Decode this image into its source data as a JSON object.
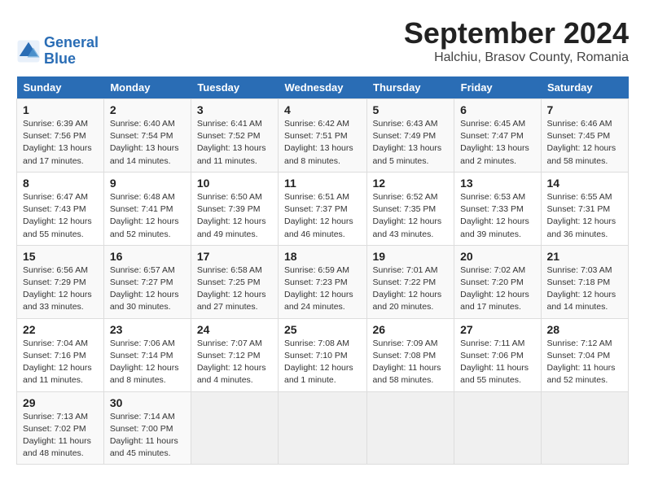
{
  "logo": {
    "line1": "General",
    "line2": "Blue"
  },
  "title": "September 2024",
  "subtitle": "Halchiu, Brasov County, Romania",
  "weekdays": [
    "Sunday",
    "Monday",
    "Tuesday",
    "Wednesday",
    "Thursday",
    "Friday",
    "Saturday"
  ],
  "weeks": [
    [
      {
        "day": "1",
        "info": "Sunrise: 6:39 AM\nSunset: 7:56 PM\nDaylight: 13 hours\nand 17 minutes."
      },
      {
        "day": "2",
        "info": "Sunrise: 6:40 AM\nSunset: 7:54 PM\nDaylight: 13 hours\nand 14 minutes."
      },
      {
        "day": "3",
        "info": "Sunrise: 6:41 AM\nSunset: 7:52 PM\nDaylight: 13 hours\nand 11 minutes."
      },
      {
        "day": "4",
        "info": "Sunrise: 6:42 AM\nSunset: 7:51 PM\nDaylight: 13 hours\nand 8 minutes."
      },
      {
        "day": "5",
        "info": "Sunrise: 6:43 AM\nSunset: 7:49 PM\nDaylight: 13 hours\nand 5 minutes."
      },
      {
        "day": "6",
        "info": "Sunrise: 6:45 AM\nSunset: 7:47 PM\nDaylight: 13 hours\nand 2 minutes."
      },
      {
        "day": "7",
        "info": "Sunrise: 6:46 AM\nSunset: 7:45 PM\nDaylight: 12 hours\nand 58 minutes."
      }
    ],
    [
      {
        "day": "8",
        "info": "Sunrise: 6:47 AM\nSunset: 7:43 PM\nDaylight: 12 hours\nand 55 minutes."
      },
      {
        "day": "9",
        "info": "Sunrise: 6:48 AM\nSunset: 7:41 PM\nDaylight: 12 hours\nand 52 minutes."
      },
      {
        "day": "10",
        "info": "Sunrise: 6:50 AM\nSunset: 7:39 PM\nDaylight: 12 hours\nand 49 minutes."
      },
      {
        "day": "11",
        "info": "Sunrise: 6:51 AM\nSunset: 7:37 PM\nDaylight: 12 hours\nand 46 minutes."
      },
      {
        "day": "12",
        "info": "Sunrise: 6:52 AM\nSunset: 7:35 PM\nDaylight: 12 hours\nand 43 minutes."
      },
      {
        "day": "13",
        "info": "Sunrise: 6:53 AM\nSunset: 7:33 PM\nDaylight: 12 hours\nand 39 minutes."
      },
      {
        "day": "14",
        "info": "Sunrise: 6:55 AM\nSunset: 7:31 PM\nDaylight: 12 hours\nand 36 minutes."
      }
    ],
    [
      {
        "day": "15",
        "info": "Sunrise: 6:56 AM\nSunset: 7:29 PM\nDaylight: 12 hours\nand 33 minutes."
      },
      {
        "day": "16",
        "info": "Sunrise: 6:57 AM\nSunset: 7:27 PM\nDaylight: 12 hours\nand 30 minutes."
      },
      {
        "day": "17",
        "info": "Sunrise: 6:58 AM\nSunset: 7:25 PM\nDaylight: 12 hours\nand 27 minutes."
      },
      {
        "day": "18",
        "info": "Sunrise: 6:59 AM\nSunset: 7:23 PM\nDaylight: 12 hours\nand 24 minutes."
      },
      {
        "day": "19",
        "info": "Sunrise: 7:01 AM\nSunset: 7:22 PM\nDaylight: 12 hours\nand 20 minutes."
      },
      {
        "day": "20",
        "info": "Sunrise: 7:02 AM\nSunset: 7:20 PM\nDaylight: 12 hours\nand 17 minutes."
      },
      {
        "day": "21",
        "info": "Sunrise: 7:03 AM\nSunset: 7:18 PM\nDaylight: 12 hours\nand 14 minutes."
      }
    ],
    [
      {
        "day": "22",
        "info": "Sunrise: 7:04 AM\nSunset: 7:16 PM\nDaylight: 12 hours\nand 11 minutes."
      },
      {
        "day": "23",
        "info": "Sunrise: 7:06 AM\nSunset: 7:14 PM\nDaylight: 12 hours\nand 8 minutes."
      },
      {
        "day": "24",
        "info": "Sunrise: 7:07 AM\nSunset: 7:12 PM\nDaylight: 12 hours\nand 4 minutes."
      },
      {
        "day": "25",
        "info": "Sunrise: 7:08 AM\nSunset: 7:10 PM\nDaylight: 12 hours\nand 1 minute."
      },
      {
        "day": "26",
        "info": "Sunrise: 7:09 AM\nSunset: 7:08 PM\nDaylight: 11 hours\nand 58 minutes."
      },
      {
        "day": "27",
        "info": "Sunrise: 7:11 AM\nSunset: 7:06 PM\nDaylight: 11 hours\nand 55 minutes."
      },
      {
        "day": "28",
        "info": "Sunrise: 7:12 AM\nSunset: 7:04 PM\nDaylight: 11 hours\nand 52 minutes."
      }
    ],
    [
      {
        "day": "29",
        "info": "Sunrise: 7:13 AM\nSunset: 7:02 PM\nDaylight: 11 hours\nand 48 minutes."
      },
      {
        "day": "30",
        "info": "Sunrise: 7:14 AM\nSunset: 7:00 PM\nDaylight: 11 hours\nand 45 minutes."
      },
      null,
      null,
      null,
      null,
      null
    ]
  ]
}
